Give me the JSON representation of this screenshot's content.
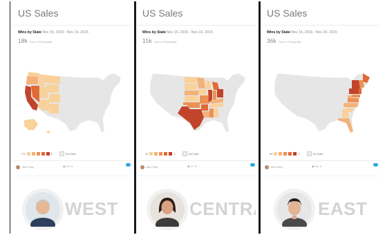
{
  "panels": [
    {
      "title": "US Sales",
      "subtitle_bold": "Wins by State",
      "subtitle_range": "Nov 15, 2015 - Nov 15, 2015",
      "metric_value": "18k",
      "metric_unit": "Sum of Probability",
      "legend_min": "175",
      "legend_max": "3",
      "legend_nodata": "No Data",
      "footer_user": "Alex Paxy",
      "footer_views": "14",
      "footer_comments": "0",
      "region_label": "WEST"
    },
    {
      "title": "US Sales",
      "subtitle_bold": "Wins by State",
      "subtitle_range": "Nov 15, 2015 - Nov 15, 2015",
      "metric_value": "15k",
      "metric_unit": "Sum of Probability",
      "legend_min": "16",
      "legend_max": "1",
      "legend_nodata": "No Data",
      "footer_user": "Alex Paxy",
      "footer_views": "17",
      "footer_comments": "0",
      "region_label": "CENTRAL"
    },
    {
      "title": "US Sales",
      "subtitle_bold": "Wins by State",
      "subtitle_range": "Nov 15, 2015 - Nov 15, 2015",
      "metric_value": "36k",
      "metric_unit": "Sum of Probability",
      "legend_min": "60",
      "legend_max": "3",
      "legend_nodata": "No Data",
      "footer_user": "Alex Paxy",
      "footer_views": "16",
      "footer_comments": "0",
      "region_label": "EAST"
    }
  ],
  "colors": {
    "no_data": "#e6e6e6",
    "light": "#f9d19a",
    "light2": "#f3b27a",
    "mid": "#ec9152",
    "strong": "#e06a36",
    "dark": "#c1442b",
    "region_text": "#d3d3d3"
  }
}
